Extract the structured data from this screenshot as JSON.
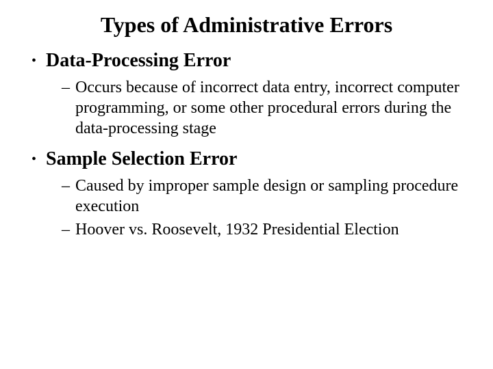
{
  "title": "Types of Administrative Errors",
  "items": [
    {
      "label": "Data-Processing Error",
      "subitems": [
        "Occurs because of incorrect data entry, incorrect computer programming, or some other procedural errors during the data-processing stage"
      ]
    },
    {
      "label": "Sample Selection Error",
      "subitems": [
        "Caused by improper sample design or sampling procedure execution",
        "Hoover vs. Roosevelt, 1932 Presidential Election"
      ]
    }
  ]
}
